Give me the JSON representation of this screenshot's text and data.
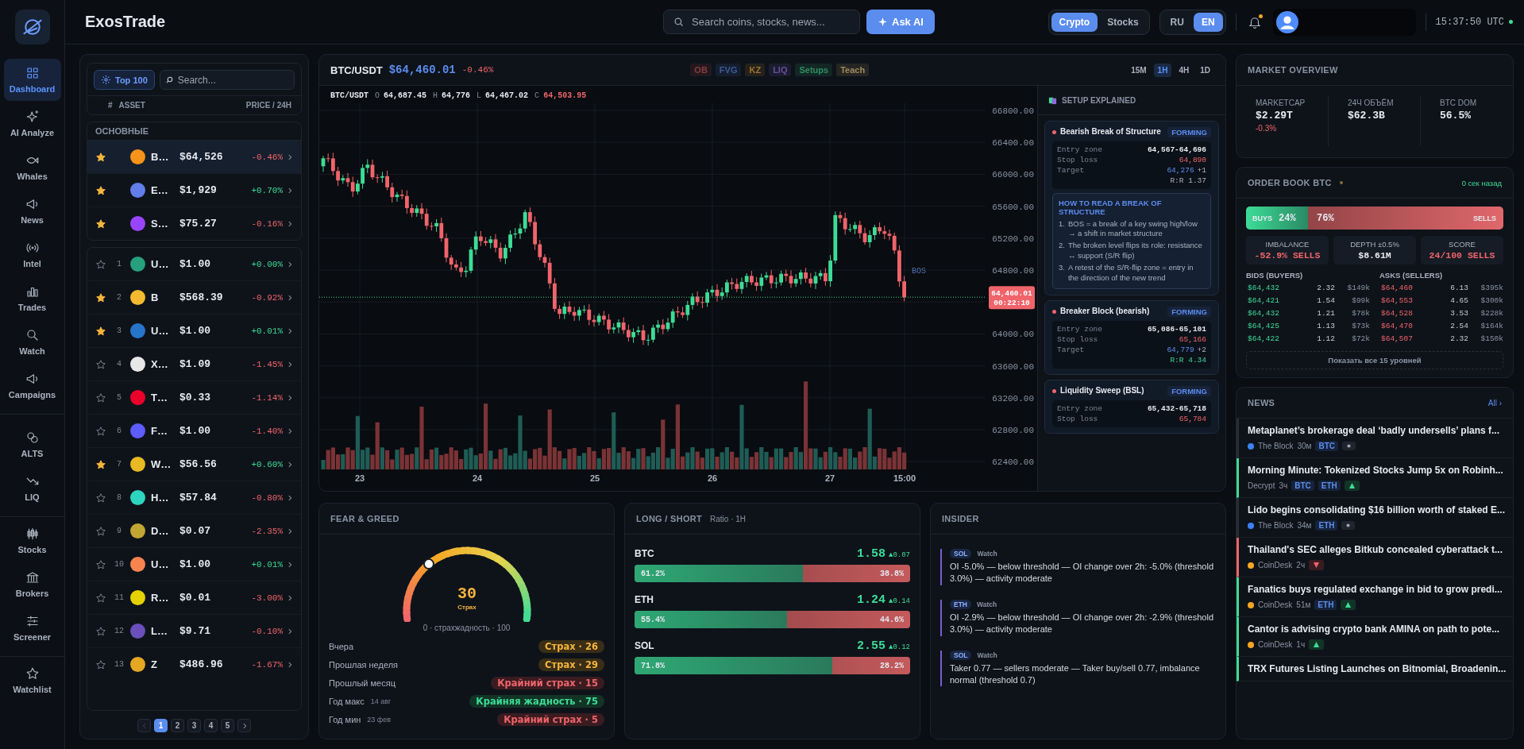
{
  "app": {
    "title": "ExosTrade"
  },
  "nav": [
    {
      "items": [
        {
          "label": "Dashboard",
          "selected": true
        },
        {
          "label": "AI Analyze",
          "selected": false
        },
        {
          "label": "Whales",
          "selected": false
        },
        {
          "label": "News",
          "selected": false
        },
        {
          "label": "Intel",
          "selected": false
        },
        {
          "label": "Trades",
          "selected": false
        },
        {
          "label": "Watch",
          "selected": false
        },
        {
          "label": "Campaigns",
          "selected": false
        }
      ]
    },
    {
      "items": [
        {
          "label": "ALTS",
          "selected": false
        },
        {
          "label": "LIQ",
          "selected": false
        }
      ]
    },
    {
      "items": [
        {
          "label": "Stocks",
          "selected": false
        },
        {
          "label": "Brokers",
          "selected": false
        },
        {
          "label": "Screener",
          "selected": false
        }
      ]
    },
    {
      "items": [
        {
          "label": "Watchlist",
          "selected": false
        }
      ]
    }
  ],
  "topbar": {
    "search": {
      "placeholder": "Search coins, stocks, news..."
    },
    "ask_button": "Ask AI",
    "markets": [
      {
        "label": "Crypto",
        "selected": true
      },
      {
        "label": "Stocks",
        "selected": false
      }
    ],
    "languages": [
      {
        "label": "RU",
        "selected": false
      },
      {
        "label": "EN",
        "selected": true
      }
    ],
    "notifications_unread": true,
    "clock": "15:37:50 UTC",
    "connected": true
  },
  "assets": {
    "top_button": "Top 100",
    "search": {
      "placeholder": "Search..."
    },
    "columns": [
      "#",
      "ASSET",
      "PRICE / 24H"
    ],
    "main_group": {
      "title": "ОСНОВНЫЕ",
      "rows": [
        {
          "name": "B…",
          "price": "$64,526",
          "change": "-0.46%",
          "up": false,
          "starred": true,
          "selected": true,
          "color": "#f7931a"
        },
        {
          "name": "E…",
          "price": "$1,929",
          "change": "+0.70%",
          "up": true,
          "starred": true,
          "selected": false,
          "color": "#627eea"
        },
        {
          "name": "S…",
          "price": "$75.27",
          "change": "-0.16%",
          "up": false,
          "starred": true,
          "selected": false,
          "color": "#9945ff"
        }
      ]
    },
    "rows": [
      {
        "rank": "1",
        "name": "U…",
        "price": "$1.00",
        "change": "+0.00%",
        "up": true,
        "starred": false,
        "color": "#26a17b"
      },
      {
        "rank": "2",
        "name": "B",
        "price": "$568.39",
        "change": "-0.92%",
        "up": false,
        "starred": true,
        "color": "#f3ba2f"
      },
      {
        "rank": "3",
        "name": "U…",
        "price": "$1.00",
        "change": "+0.01%",
        "up": true,
        "starred": true,
        "color": "#2775ca"
      },
      {
        "rank": "4",
        "name": "X…",
        "price": "$1.09",
        "change": "-1.45%",
        "up": false,
        "starred": false,
        "color": "#e8e8e8"
      },
      {
        "rank": "5",
        "name": "T…",
        "price": "$0.33",
        "change": "-1.14%",
        "up": false,
        "starred": false,
        "color": "#eb0029"
      },
      {
        "rank": "6",
        "name": "F…",
        "price": "$1.00",
        "change": "-1.40%",
        "up": false,
        "starred": false,
        "color": "#5c5cff"
      },
      {
        "rank": "7",
        "name": "W…",
        "price": "$56.56",
        "change": "+0.60%",
        "up": true,
        "starred": true,
        "color": "#e8b923"
      },
      {
        "rank": "8",
        "name": "H…",
        "price": "$57.84",
        "change": "-0.80%",
        "up": false,
        "starred": false,
        "color": "#2dd4bf"
      },
      {
        "rank": "9",
        "name": "D…",
        "price": "$0.07",
        "change": "-2.35%",
        "up": false,
        "starred": false,
        "color": "#c2a633"
      },
      {
        "rank": "10",
        "name": "U…",
        "price": "$1.00",
        "change": "+0.01%",
        "up": true,
        "starred": false,
        "color": "#f7844f"
      },
      {
        "rank": "11",
        "name": "R…",
        "price": "$0.01",
        "change": "-3.00%",
        "up": false,
        "starred": false,
        "color": "#e6d200"
      },
      {
        "rank": "12",
        "name": "L…",
        "price": "$9.71",
        "change": "-0.10%",
        "up": false,
        "starred": false,
        "color": "#6b4fbb"
      },
      {
        "rank": "13",
        "name": "Z",
        "price": "$486.96",
        "change": "-1.67%",
        "up": false,
        "starred": false,
        "color": "#e5a823"
      }
    ],
    "pagination": [
      {
        "label": "1",
        "selected": true
      },
      {
        "label": "2",
        "selected": false
      },
      {
        "label": "3",
        "selected": false
      },
      {
        "label": "4",
        "selected": false
      },
      {
        "label": "5",
        "selected": false
      }
    ]
  },
  "chart": {
    "pair": "BTC/USDT",
    "price": "$64,460.01",
    "change": "-0.46%",
    "overlays": [
      {
        "label": "OB",
        "color": "#8a3a3d"
      },
      {
        "label": "FVG",
        "color": "#3d5a99"
      },
      {
        "label": "KZ",
        "color": "#a0722c"
      },
      {
        "label": "LIQ",
        "color": "#6a4f9c"
      },
      {
        "label": "Setups",
        "color": "#2f8f62"
      },
      {
        "label": "Teach",
        "color": "#a08a5c"
      }
    ],
    "timeframes": [
      {
        "label": "15M",
        "selected": false
      },
      {
        "label": "1H",
        "selected": true
      },
      {
        "label": "4H",
        "selected": false
      },
      {
        "label": "1D",
        "selected": false
      }
    ],
    "ohlc": {
      "symbol": "BTC/USDT",
      "fields": [
        {
          "key": "O",
          "value": "64,687.45",
          "down": false
        },
        {
          "key": "H",
          "value": "64,776",
          "down": false
        },
        {
          "key": "L",
          "value": "64,467.02",
          "down": false
        },
        {
          "key": "C",
          "value": "64,503.95",
          "down": true
        }
      ]
    },
    "y_ticks": [
      "66800.00",
      "66400.00",
      "66000.00",
      "65600.00",
      "65200.00",
      "64800.00",
      "64000.00",
      "63600.00",
      "63200.00",
      "62800.00",
      "62400.00"
    ],
    "x_labels": [
      "23",
      "24",
      "25",
      "26",
      "27",
      "15:00"
    ],
    "price_tag": {
      "price": "64,460.01",
      "countdown": "00:22:10"
    },
    "marker": "BOS"
  },
  "setups": {
    "title": "SETUP EXPLAINED",
    "cards": [
      {
        "title": "Bearish Break of Structure",
        "status": "FORMING",
        "rows": [
          {
            "label": "Entry zone",
            "value": "64,567-64,696",
            "kind": "entry"
          },
          {
            "label": "Stop loss",
            "value": "64,890",
            "kind": "stop"
          },
          {
            "label": "Target",
            "value": "64,276",
            "extra": "+1",
            "kind": "target"
          }
        ],
        "rr": "R:R 1.37",
        "rr_good": false,
        "howto": {
          "title": "HOW TO READ A BREAK OF STRUCTURE",
          "steps": [
            {
              "num": "1.",
              "text": "BOS = a break of a key swing high/low → a shift in market structure"
            },
            {
              "num": "2.",
              "text": "The broken level flips its role: resistance ↔ support (S/R flip)"
            },
            {
              "num": "3.",
              "text": "A retest of the S/R-flip zone = entry in the direction of the new trend"
            }
          ]
        }
      },
      {
        "title": "Breaker Block (bearish)",
        "status": "FORMING",
        "rows": [
          {
            "label": "Entry zone",
            "value": "65,086-65,101",
            "kind": "entry"
          },
          {
            "label": "Stop loss",
            "value": "65,166",
            "kind": "stop"
          },
          {
            "label": "Target",
            "value": "64,779",
            "extra": "+2",
            "kind": "target"
          }
        ],
        "rr": "R:R 4.34",
        "rr_good": true
      },
      {
        "title": "Liquidity Sweep (BSL)",
        "status": "FORMING",
        "rows": [
          {
            "label": "Entry zone",
            "value": "65,432-65,718",
            "kind": "entry"
          },
          {
            "label": "Stop loss",
            "value": "65,784",
            "kind": "stop"
          }
        ]
      }
    ]
  },
  "fear_greed": {
    "title": "FEAR & GREED",
    "value": "30",
    "label": "Страх",
    "level": 0.3,
    "scale": "0 · страхжадность · 100",
    "history": [
      {
        "label": "Вчера",
        "value": "Страх · 26",
        "kind": "fear"
      },
      {
        "label": "Прошлая неделя",
        "value": "Страх · 29",
        "kind": "fear"
      },
      {
        "label": "Прошлый месяц",
        "value": "Крайний страх · 15",
        "kind": "extreme-fear"
      },
      {
        "label": "Год макс",
        "date": "14 авг",
        "value": "Крайняя жадность · 75",
        "kind": "extreme-greed"
      },
      {
        "label": "Год мин",
        "date": "23 фев",
        "value": "Крайний страх · 5",
        "kind": "extreme-fear"
      }
    ]
  },
  "long_short": {
    "title": "LONG / SHORT",
    "subtitle": "Ratio · 1H",
    "rows": [
      {
        "symbol": "BTC",
        "ratio": "1.58",
        "delta": "▲0.07",
        "long": "61.2%",
        "short": "38.8%",
        "level": 0.612
      },
      {
        "symbol": "ETH",
        "ratio": "1.24",
        "delta": "▲0.14",
        "long": "55.4%",
        "short": "44.6%",
        "level": 0.554
      },
      {
        "symbol": "SOL",
        "ratio": "2.55",
        "delta": "▲0.12",
        "long": "71.8%",
        "short": "28.2%",
        "level": 0.718
      }
    ]
  },
  "insider": {
    "title": "INSIDER",
    "items": [
      {
        "tag": "SOL",
        "status": "Watch",
        "text": "OI -5.0% — below threshold — OI change over 2h: -5.0% (threshold 3.0%) — activity moderate"
      },
      {
        "tag": "ETH",
        "status": "Watch",
        "text": "OI -2.9% — below threshold — OI change over 2h: -2.9% (threshold 3.0%) — activity moderate"
      },
      {
        "tag": "SOL",
        "status": "Watch",
        "text": "Taker 0.77 — sellers moderate — Taker buy/sell 0.77, imbalance normal (threshold 0.7)"
      }
    ]
  },
  "market_overview": {
    "title": "MARKET OVERVIEW",
    "stats": [
      {
        "label": "MARKETCAP",
        "value": "$2.29T",
        "change": "-0.3%"
      },
      {
        "label": "24Ч ОБЪЁМ",
        "value": "$62.3B"
      },
      {
        "label": "BTC DOM",
        "value": "56.5%"
      }
    ]
  },
  "order_book": {
    "title": "ORDER BOOK BTC",
    "updated": "0 сек назад",
    "buys_label": "BUYS",
    "buys": "24%",
    "sells": "76%",
    "sells_label": "SELLS",
    "level": 0.24,
    "stats": [
      {
        "label": "IMBALANCE",
        "value": "-52.9% SELLS",
        "negative": true
      },
      {
        "label": "DEPTH ±0.5%",
        "value": "$8.61M",
        "negative": false
      },
      {
        "label": "SCORE",
        "value": "24/100 SELLS",
        "negative": true
      }
    ],
    "bids_title": "BIDS (BUYERS)",
    "asks_title": "ASKS (SELLERS)",
    "bids": [
      [
        "$64,432",
        "2.32",
        "$149k"
      ],
      [
        "$64,421",
        "1.54",
        "$99k"
      ],
      [
        "$64,432",
        "1.21",
        "$78k"
      ],
      [
        "$64,425",
        "1.13",
        "$73k"
      ],
      [
        "$64,422",
        "1.12",
        "$72k"
      ]
    ],
    "asks": [
      [
        "$64,460",
        "6.13",
        "$395k"
      ],
      [
        "$64,553",
        "4.65",
        "$300k"
      ],
      [
        "$64,528",
        "3.53",
        "$228k"
      ],
      [
        "$64,470",
        "2.54",
        "$164k"
      ],
      [
        "$64,507",
        "2.32",
        "$150k"
      ]
    ],
    "show_all": "Показать все 15 уровней"
  },
  "news": {
    "title": "NEWS",
    "all_link": "All ›",
    "items": [
      {
        "title": "Metaplanet’s brokerage deal ‘badly undersells’ plans f...",
        "source": "The Block",
        "color": "#3b82f6",
        "time": "30м",
        "tags": [
          "BTC"
        ],
        "kind": "neutral"
      },
      {
        "title": "Morning Minute: Tokenized Stocks Jump 5x on Robinh...",
        "source": "Decrypt",
        "time": "3ч",
        "tags": [
          "BTC",
          "ETH"
        ],
        "kind": "up"
      },
      {
        "title": "Lido begins consolidating $16 billion worth of staked E...",
        "source": "The Block",
        "color": "#3b82f6",
        "time": "34м",
        "tags": [
          "ETH"
        ],
        "kind": "neutral"
      },
      {
        "title": "Thailand's SEC alleges Bitkub concealed cyberattack t...",
        "source": "CoinDesk",
        "color": "#f5a524",
        "time": "2ч",
        "kind": "down"
      },
      {
        "title": "Fanatics buys regulated exchange in bid to grow predi...",
        "source": "CoinDesk",
        "color": "#f5a524",
        "time": "51м",
        "tags": [
          "ETH"
        ],
        "kind": "up"
      },
      {
        "title": "Cantor is advising crypto bank AMINA on path to pote...",
        "source": "CoinDesk",
        "color": "#f5a524",
        "time": "1ч",
        "kind": "up"
      },
      {
        "title": "TRX Futures Listing Launches on Bitnomial, Broadenin...",
        "kind": "up"
      }
    ]
  }
}
